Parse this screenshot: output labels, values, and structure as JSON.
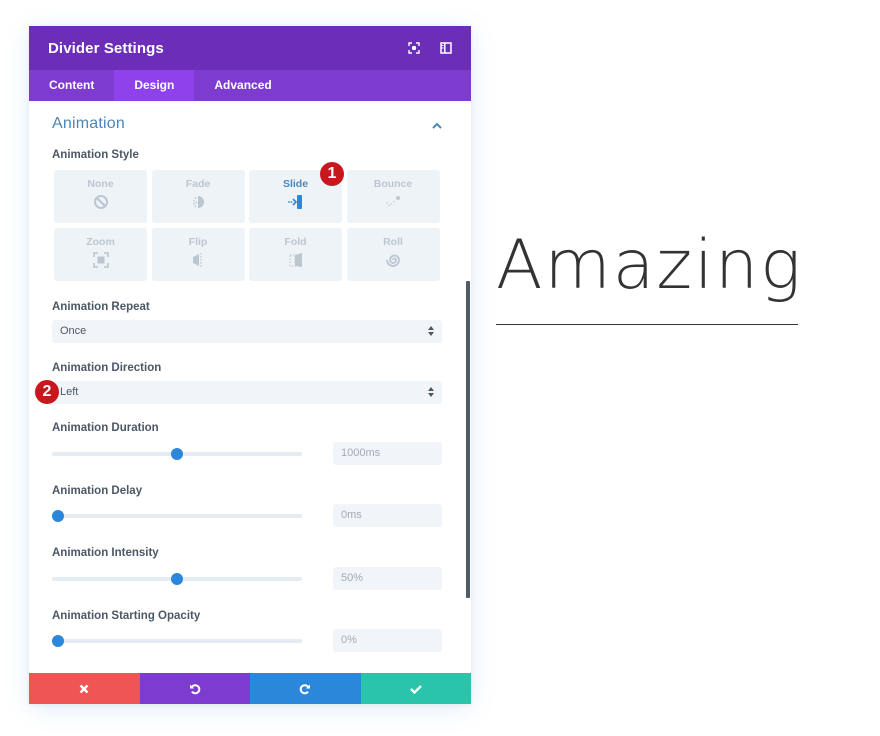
{
  "modal": {
    "title": "Divider Settings",
    "header_icons": [
      "fullscreen-icon",
      "sidebar-toggle-icon"
    ],
    "tabs": [
      {
        "label": "Content",
        "active": false
      },
      {
        "label": "Design",
        "active": true
      },
      {
        "label": "Advanced",
        "active": false
      }
    ],
    "section": {
      "title": "Animation",
      "expanded": true,
      "style_label": "Animation Style",
      "styles": [
        {
          "label": "None",
          "icon": "none-icon",
          "active": false
        },
        {
          "label": "Fade",
          "icon": "fade-icon",
          "active": false
        },
        {
          "label": "Slide",
          "icon": "slide-icon",
          "active": true
        },
        {
          "label": "Bounce",
          "icon": "bounce-icon",
          "active": false
        },
        {
          "label": "Zoom",
          "icon": "zoom-icon",
          "active": false
        },
        {
          "label": "Flip",
          "icon": "flip-icon",
          "active": false
        },
        {
          "label": "Fold",
          "icon": "fold-icon",
          "active": false
        },
        {
          "label": "Roll",
          "icon": "roll-icon",
          "active": false
        }
      ],
      "repeat": {
        "label": "Animation Repeat",
        "value": "Once"
      },
      "direction": {
        "label": "Animation Direction",
        "value": "Left"
      },
      "duration": {
        "label": "Animation Duration",
        "value": "1000ms",
        "fraction": 0.5
      },
      "delay": {
        "label": "Animation Delay",
        "value": "0ms",
        "fraction": 0.0
      },
      "intensity": {
        "label": "Animation Intensity",
        "value": "50%",
        "fraction": 0.5
      },
      "opacity": {
        "label": "Animation Starting Opacity",
        "value": "0%",
        "fraction": 0.0
      }
    },
    "footer": {
      "buttons": [
        {
          "name": "cancel",
          "icon": "close-icon",
          "color": "#ef5555"
        },
        {
          "name": "undo",
          "icon": "undo-icon",
          "color": "#7e3bd0"
        },
        {
          "name": "redo",
          "icon": "redo-icon",
          "color": "#2b87da"
        },
        {
          "name": "save",
          "icon": "check-icon",
          "color": "#29c4a9"
        }
      ]
    }
  },
  "annotations": [
    {
      "number": "1"
    },
    {
      "number": "2"
    }
  ],
  "preview": {
    "text": "Amazing"
  },
  "colors": {
    "header": "#6c2eb9",
    "tabs": "#7e3bd0",
    "tab_active": "#8f42ec",
    "accent": "#2b87da",
    "badge": "#c8181e"
  }
}
